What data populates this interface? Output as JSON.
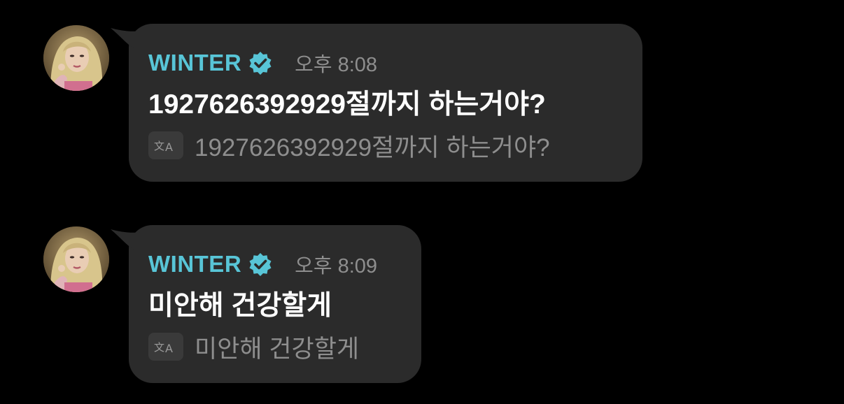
{
  "messages": [
    {
      "sender": "WINTER",
      "time": "오후 8:08",
      "text": "1927626392929절까지 하는거야?",
      "translation": "1927626392929절까지 하는거야?",
      "verified": true
    },
    {
      "sender": "WINTER",
      "time": "오후 8:09",
      "text": "미안해 건강할게",
      "translation": "미안해 건강할게",
      "verified": true
    }
  ],
  "icons": {
    "verified": "verified-badge-icon",
    "translate": "translate-icon",
    "avatar": "avatar-image"
  },
  "colors": {
    "background": "#000000",
    "bubble": "#2b2b2b",
    "sender": "#58c5d7",
    "text": "#ffffff",
    "muted": "#8e8e8e"
  }
}
